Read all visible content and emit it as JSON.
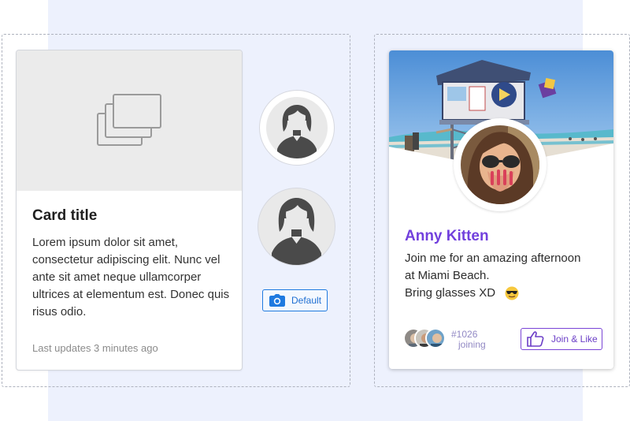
{
  "card": {
    "title": "Card title",
    "body": "Lorem ipsum dolor sit amet, consectetur adipiscing elit. Nunc vel ante sit amet neque ullamcorper ultrices at elementum est. Donec quis risus odio.",
    "meta": "Last updates 3 minutes ago",
    "media_icon": "image-gallery-icon"
  },
  "avatars": {
    "icon": "user-icon"
  },
  "default_button": {
    "label": "Default",
    "icon": "camera-icon",
    "color": "#1f7ae0"
  },
  "profile": {
    "name": "Anny Kitten",
    "bio_lines": [
      "Join me for an amazing afternoon",
      "at Miami Beach.",
      "Bring glasses XD"
    ],
    "bio_emoji": "sunglasses-emoji",
    "join_count": "#1026",
    "join_label": "joining",
    "join_button": "Join & Like",
    "join_icon": "thumbs-up-icon",
    "accent": "#7240dd"
  }
}
